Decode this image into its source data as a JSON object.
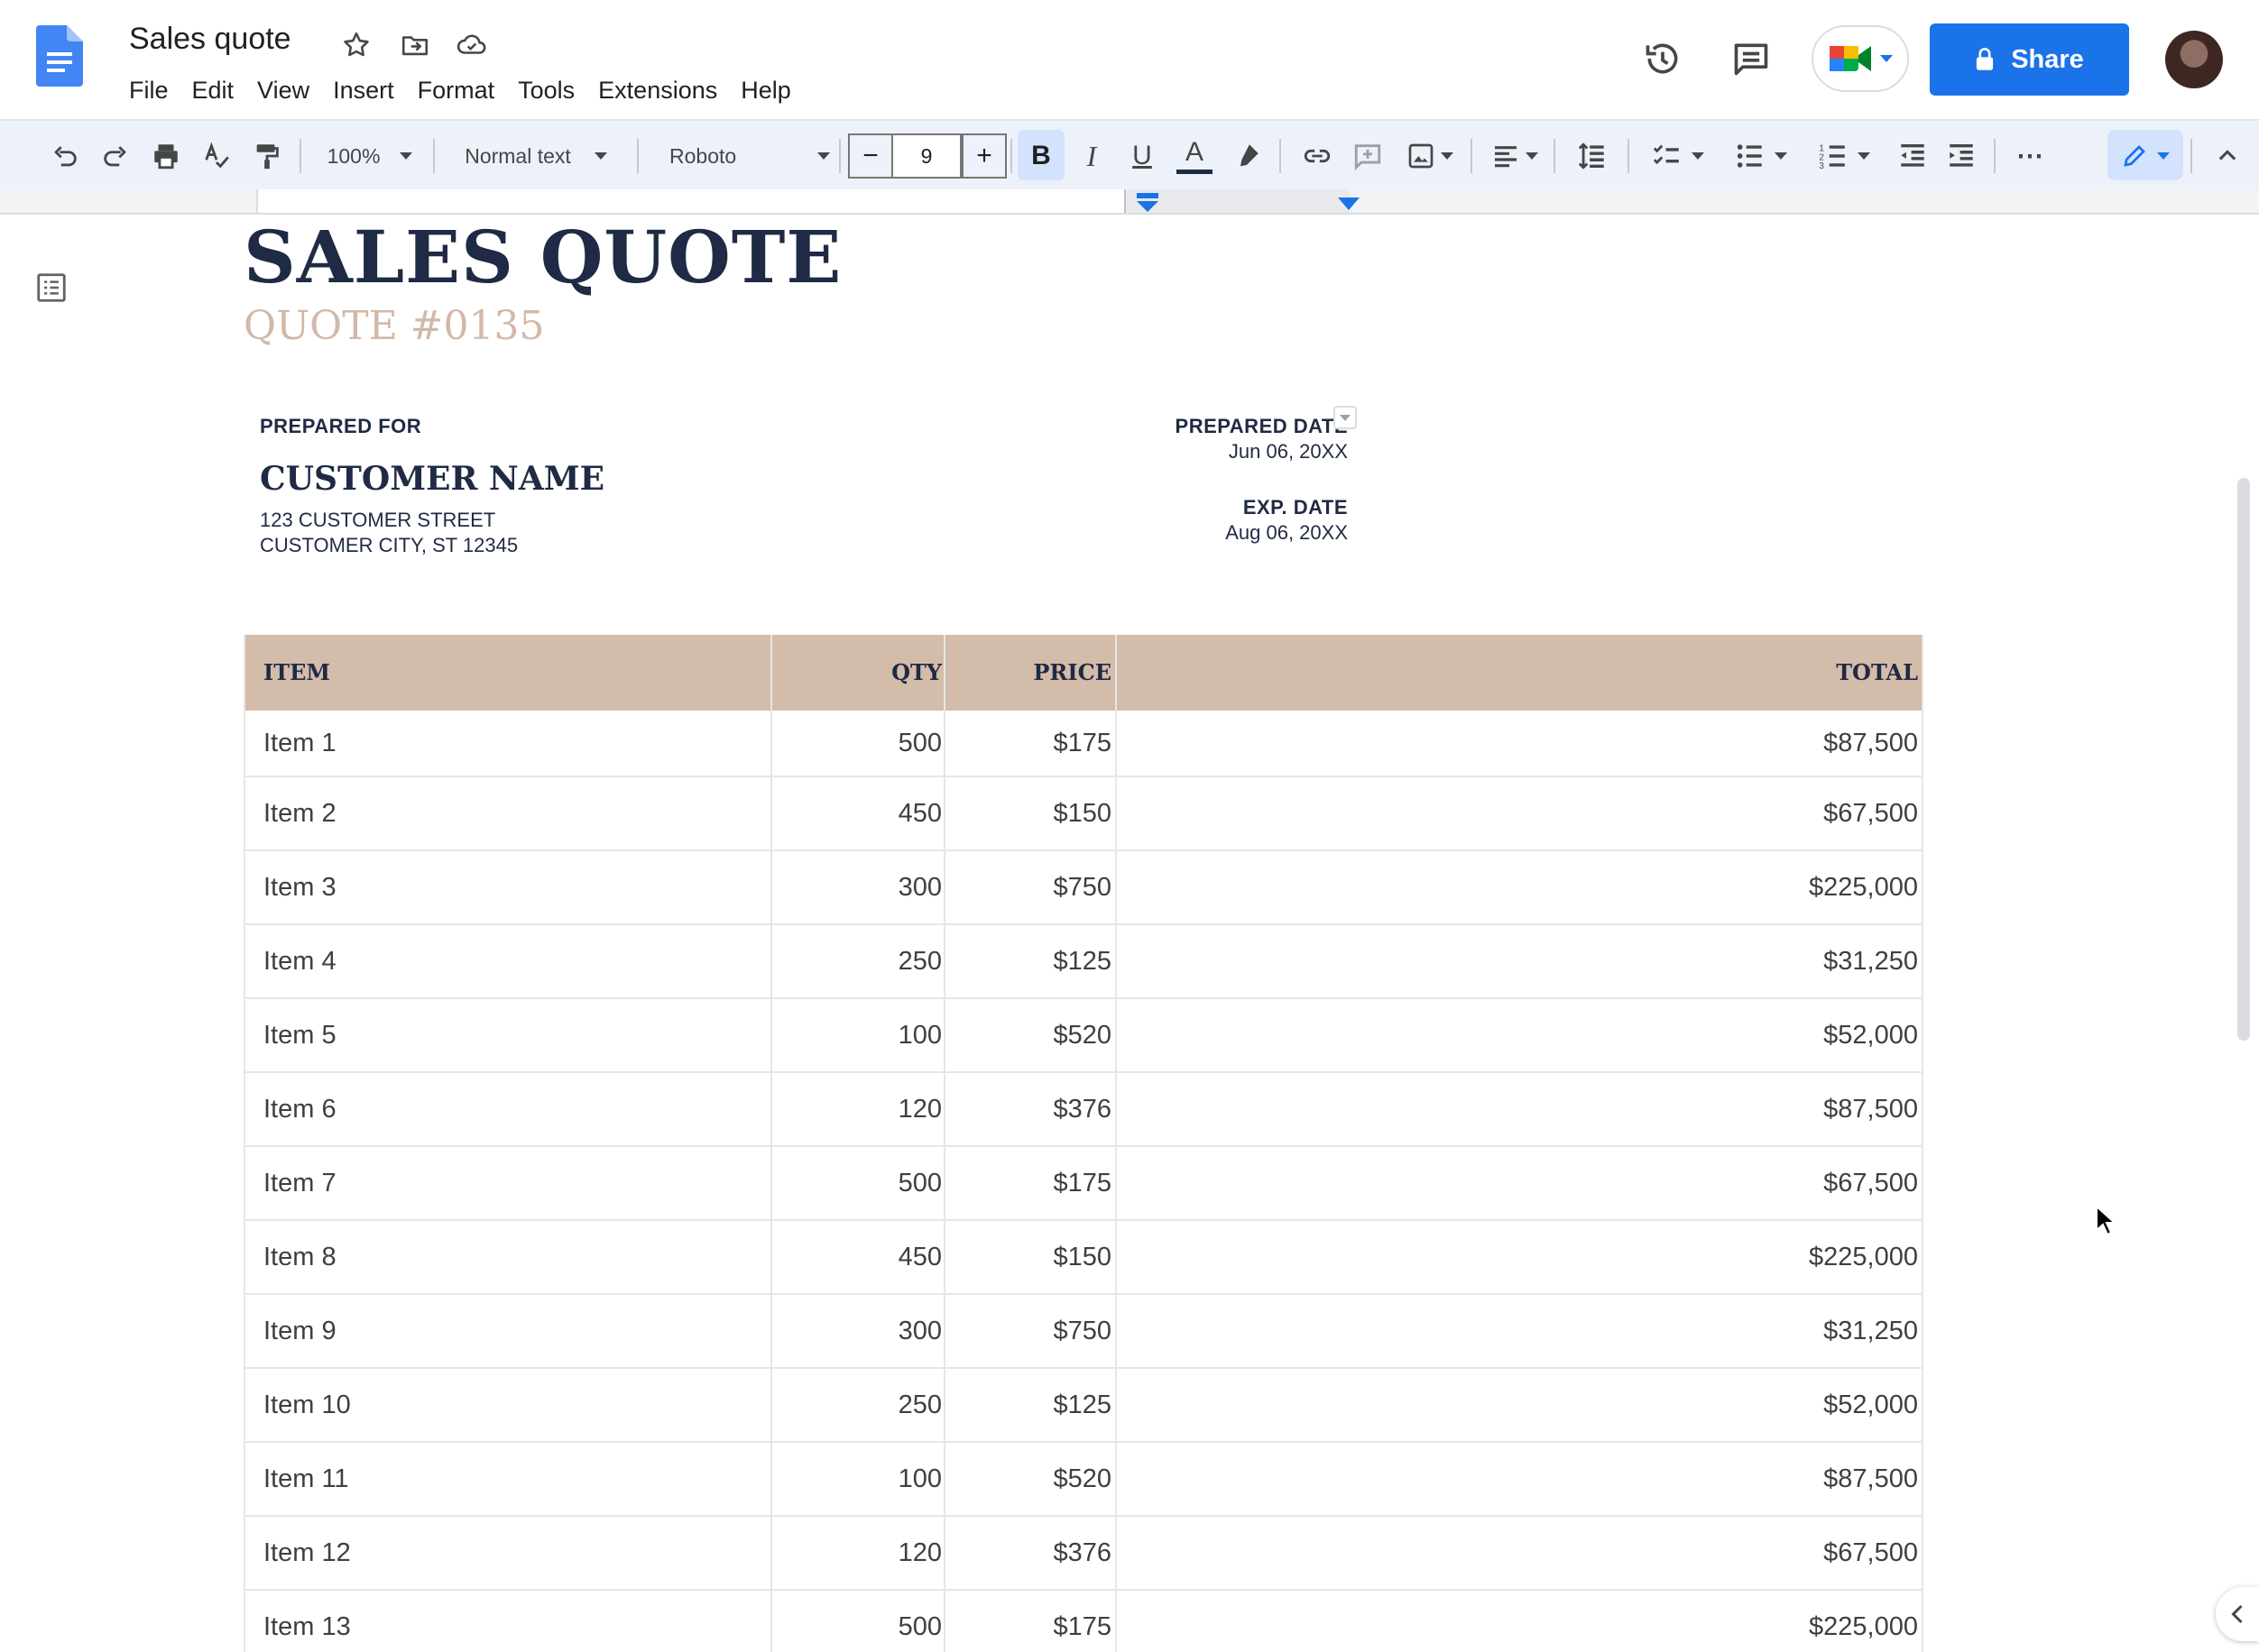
{
  "app": {
    "document_title": "Sales quote",
    "menu": [
      "File",
      "Edit",
      "View",
      "Insert",
      "Format",
      "Tools",
      "Extensions",
      "Help"
    ],
    "share_label": "Share"
  },
  "toolbar": {
    "zoom": "100%",
    "style": "Normal text",
    "font": "Roboto",
    "font_size": "9",
    "minus": "−",
    "plus": "+",
    "bold": "B",
    "italic": "I",
    "underline": "U",
    "text_color": "A",
    "more": "⋯"
  },
  "document": {
    "title": "SALES QUOTE",
    "quote_number": "QUOTE #0135",
    "prepared_for_label": "PREPARED FOR",
    "customer_name": "CUSTOMER NAME",
    "address_line1": "123 CUSTOMER STREET",
    "address_line2": "CUSTOMER CITY, ST 12345",
    "prepared_date_label": "PREPARED DATE",
    "prepared_date": "Jun 06, 20XX",
    "exp_date_label": "EXP. DATE",
    "exp_date": "Aug 06, 20XX"
  },
  "table": {
    "headers": [
      "ITEM",
      "QTY",
      "PRICE",
      "TOTAL"
    ],
    "rows": [
      [
        "Item 1",
        "500",
        "$175",
        "$87,500"
      ],
      [
        "Item 2",
        "450",
        "$150",
        "$67,500"
      ],
      [
        "Item 3",
        "300",
        "$750",
        "$225,000"
      ],
      [
        "Item 4",
        "250",
        "$125",
        "$31,250"
      ],
      [
        "Item 5",
        "100",
        "$520",
        "$52,000"
      ],
      [
        "Item 6",
        "120",
        "$376",
        "$87,500"
      ],
      [
        "Item 7",
        "500",
        "$175",
        "$67,500"
      ],
      [
        "Item 8",
        "450",
        "$150",
        "$225,000"
      ],
      [
        "Item 9",
        "300",
        "$750",
        "$31,250"
      ],
      [
        "Item 10",
        "250",
        "$125",
        "$52,000"
      ],
      [
        "Item 11",
        "100",
        "$520",
        "$87,500"
      ],
      [
        "Item 12",
        "120",
        "$376",
        "$67,500"
      ],
      [
        "Item 13",
        "500",
        "$175",
        "$225,000"
      ]
    ]
  },
  "colors": {
    "brand_blue": "#1a73e8",
    "heading_navy": "#1f2a44",
    "quote_tan": "#d2b8a8",
    "table_header": "#d4bcab",
    "toolbar_bg": "#edf2fa"
  },
  "icons": [
    "docs-logo-icon",
    "star-icon",
    "move-folder-icon",
    "cloud-saved-icon",
    "version-history-icon",
    "comments-icon",
    "meet-icon",
    "lock-icon",
    "undo-icon",
    "redo-icon",
    "print-icon",
    "spellcheck-icon",
    "paint-format-icon",
    "highlight-icon",
    "link-icon",
    "add-comment-icon",
    "image-icon",
    "align-icon",
    "line-spacing-icon",
    "checklist-icon",
    "bullet-list-icon",
    "numbered-list-icon",
    "decrease-indent-icon",
    "increase-indent-icon",
    "editing-mode-icon",
    "collapse-icon",
    "outline-icon"
  ]
}
